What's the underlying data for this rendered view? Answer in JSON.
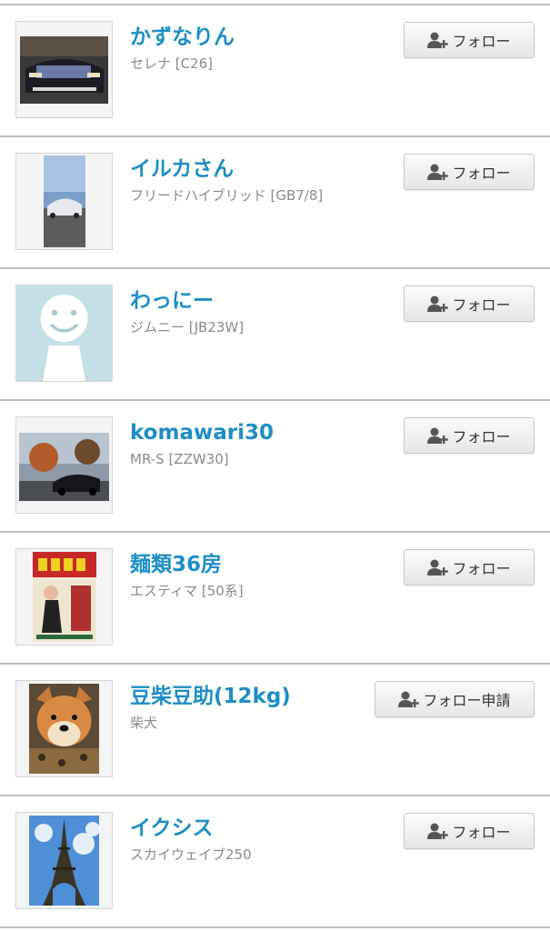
{
  "follow_list": {
    "users": [
      {
        "name": "かずなりん",
        "car": "セレナ [C26]",
        "button": "フォロー",
        "thumb": "car-photo"
      },
      {
        "name": "イルカさん",
        "car": "フリードハイブリッド [GB7/8]",
        "button": "フォロー",
        "thumb": "car-photo"
      },
      {
        "name": "わっにー",
        "car": "ジムニー [JB23W]",
        "button": "フォロー",
        "thumb": "default-avatar"
      },
      {
        "name": "komawari30",
        "car": "MR-S [ZZW30]",
        "button": "フォロー",
        "thumb": "car-photo"
      },
      {
        "name": "麺類36房",
        "car": "エスティマ [50系]",
        "button": "フォロー",
        "thumb": "poster"
      },
      {
        "name": "豆柴豆助(12kg)",
        "car": "柴犬",
        "button": "フォロー申請",
        "thumb": "dog-photo"
      },
      {
        "name": "イクシス",
        "car": "スカイウェイブ250",
        "button": "フォロー",
        "thumb": "tower-photo"
      }
    ]
  },
  "colors": {
    "username": "#1d8fc4",
    "subtext": "#8a8a8a",
    "divider": "#bdbdbd"
  }
}
